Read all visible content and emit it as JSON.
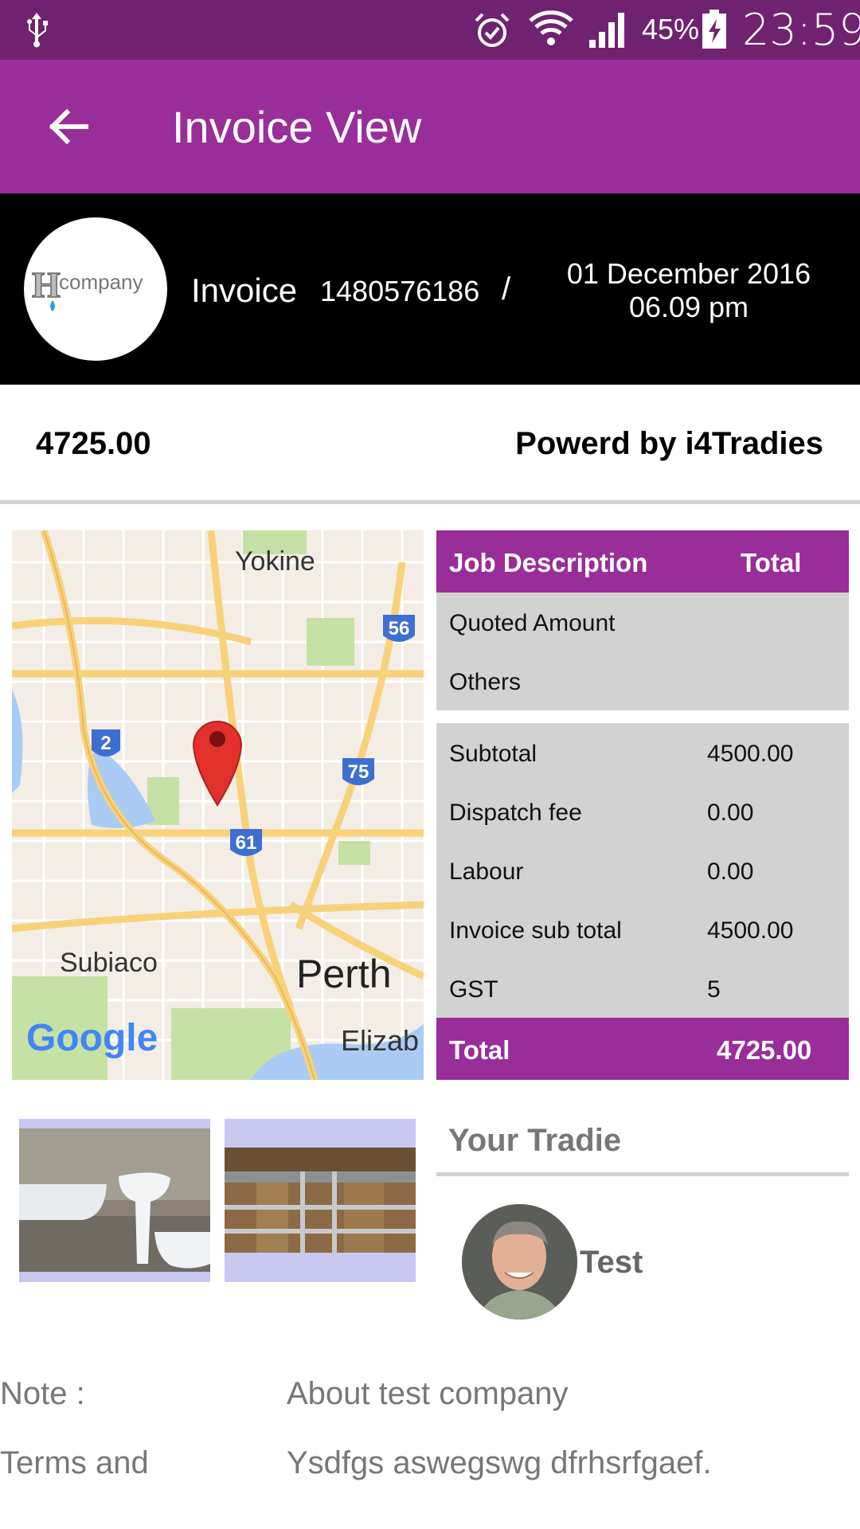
{
  "status_bar": {
    "battery_percent": "45%",
    "time": "23:59",
    "icons": [
      "usb-icon",
      "alarm-icon",
      "wifi-icon",
      "signal-icon",
      "battery-charging-icon"
    ]
  },
  "app_bar": {
    "title": "Invoice View",
    "back_icon": "arrow-left-icon",
    "color": "#992d99"
  },
  "invoice_header": {
    "logo_text": "company",
    "logo_letter": "H",
    "label": "Invoice",
    "number": "1480576186",
    "separator": "/",
    "date": "01 December 2016",
    "time": "06.09 pm"
  },
  "summary": {
    "amount": "4725.00",
    "powered_by": "Powerd by i4Tradies"
  },
  "map": {
    "labels": {
      "yokine": "Yokine",
      "subiaco": "Subiaco",
      "perth": "Perth",
      "elizab": "Elizab",
      "google": "Google"
    },
    "shields": [
      "56",
      "2",
      "75",
      "61"
    ]
  },
  "job_table": {
    "header": {
      "description": "Job Description",
      "total": "Total"
    },
    "items": [
      {
        "label": "Quoted Amount",
        "value": ""
      },
      {
        "label": "Others",
        "value": ""
      }
    ],
    "breakdown": [
      {
        "label": "Subtotal",
        "value": "4500.00"
      },
      {
        "label": "Dispatch fee",
        "value": "0.00"
      },
      {
        "label": "Labour",
        "value": "0.00"
      },
      {
        "label": "Invoice sub total",
        "value": "4500.00"
      },
      {
        "label": "GST",
        "value": "5"
      }
    ],
    "total": {
      "label": "Total",
      "value": "4725.00"
    }
  },
  "tradie": {
    "section_title": "Your Tradie",
    "name": "Test"
  },
  "notes": [
    {
      "label": "Note :",
      "value": "About test company"
    },
    {
      "label": "Terms and",
      "value": "Ysdfgs aswegswg dfrhsrfgaef."
    }
  ]
}
